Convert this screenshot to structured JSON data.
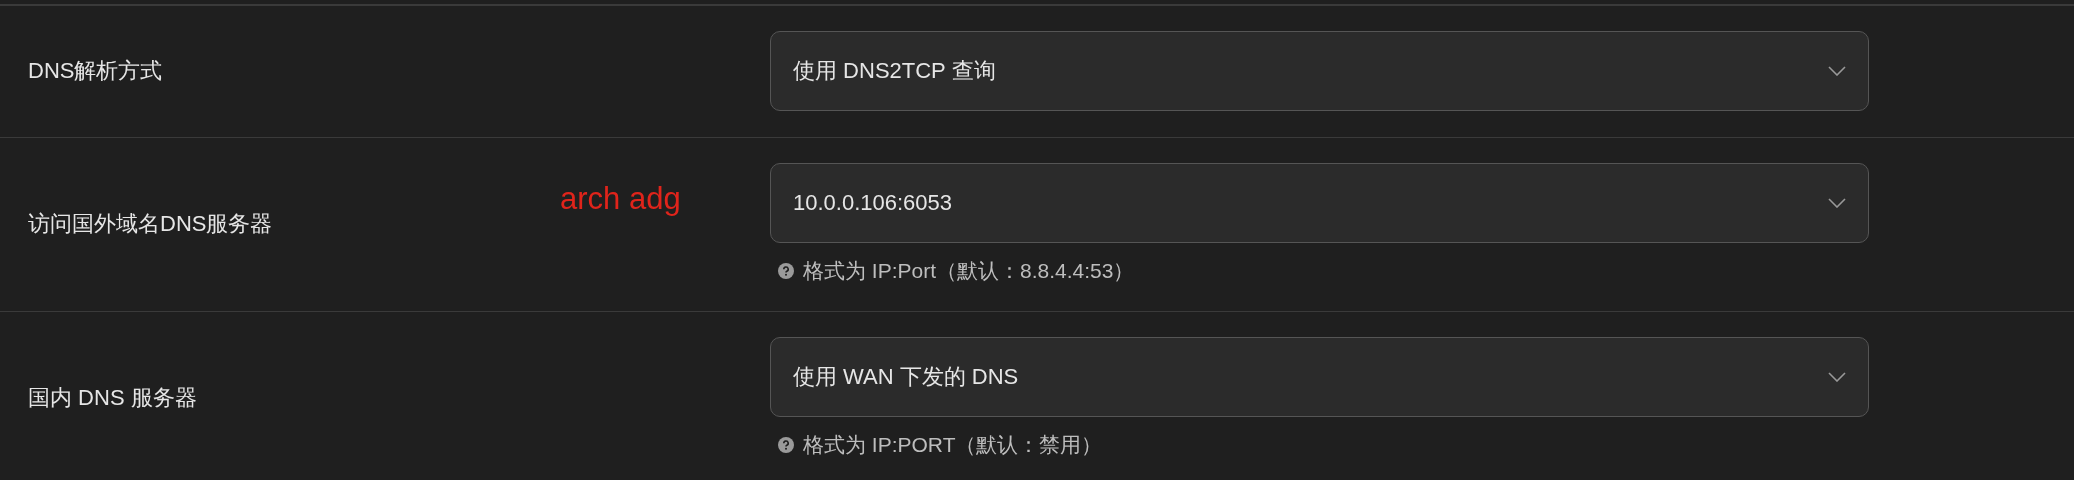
{
  "rows": [
    {
      "label": "DNS解析方式",
      "value": "使用 DNS2TCP 查询"
    },
    {
      "label": "访问国外域名DNS服务器",
      "value": "10.0.0.106:6053",
      "hint": "格式为 IP:Port（默认：8.8.4.4:53）",
      "annotation": "arch adg"
    },
    {
      "label": "国内 DNS 服务器",
      "value": "使用 WAN 下发的 DNS",
      "hint": "格式为 IP:PORT（默认：禁用）"
    }
  ]
}
